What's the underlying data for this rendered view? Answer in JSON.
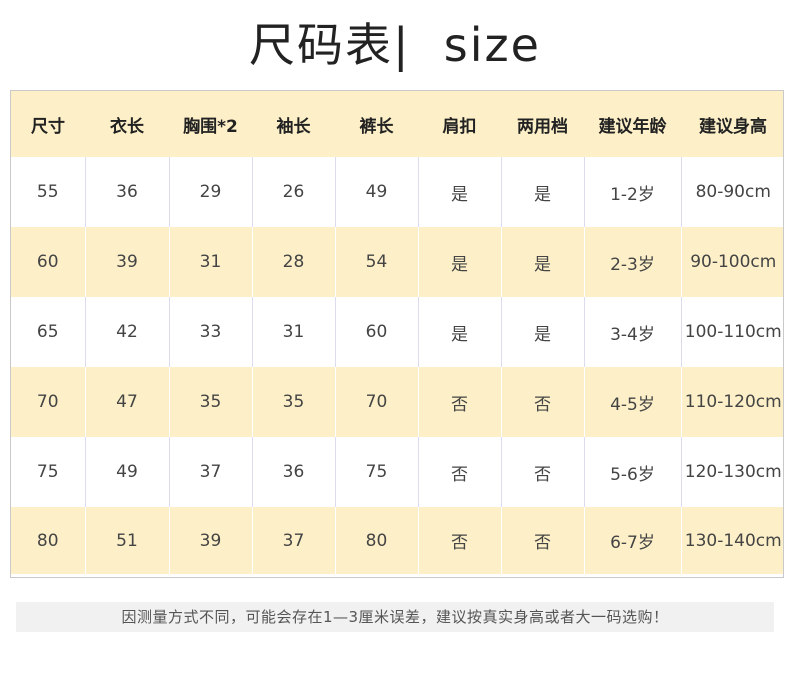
{
  "title": "尺码表|  size",
  "table": {
    "headers": [
      "尺寸",
      "衣长",
      "胸围*2",
      "袖长",
      "裤长",
      "肩扣",
      "两用档",
      "建议年龄",
      "建议身高"
    ],
    "rows": [
      [
        "55",
        "36",
        "29",
        "26",
        "49",
        "是",
        "是",
        "1-2岁",
        "80-90cm"
      ],
      [
        "60",
        "39",
        "31",
        "28",
        "54",
        "是",
        "是",
        "2-3岁",
        "90-100cm"
      ],
      [
        "65",
        "42",
        "33",
        "31",
        "60",
        "是",
        "是",
        "3-4岁",
        "100-110cm"
      ],
      [
        "70",
        "47",
        "35",
        "35",
        "70",
        "否",
        "否",
        "4-5岁",
        "110-120cm"
      ],
      [
        "75",
        "49",
        "37",
        "36",
        "75",
        "否",
        "否",
        "5-6岁",
        "120-130cm"
      ],
      [
        "80",
        "51",
        "39",
        "37",
        "80",
        "否",
        "否",
        "6-7岁",
        "130-140cm"
      ]
    ]
  },
  "note": "因测量方式不同，可能会存在1—3厘米误差，建议按真实身高或者大一码选购！",
  "colors": {
    "header_bg": "#fdf0c8",
    "stripe_bg": "#fdf0c8",
    "row_bg": "#ffffff",
    "note_bg": "#f1f1f1"
  }
}
